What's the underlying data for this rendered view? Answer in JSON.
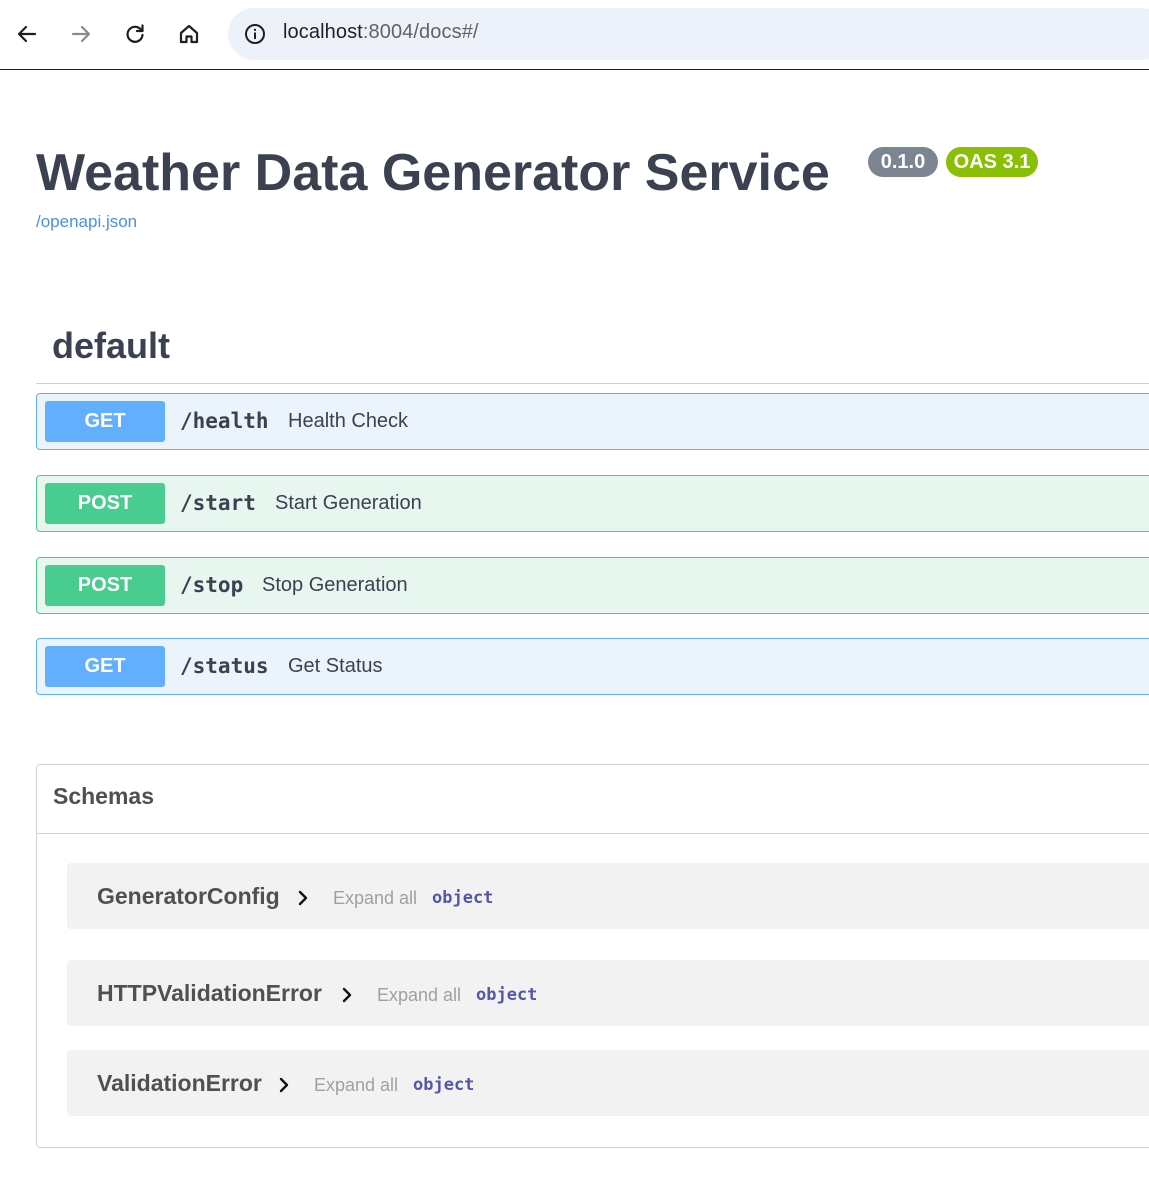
{
  "browser": {
    "url_host": "localhost",
    "url_rest": ":8004/docs#/"
  },
  "header": {
    "title": "Weather Data Generator Service",
    "version_badge": "0.1.0",
    "oas_badge": "OAS 3.1",
    "openapi_link": "/openapi.json"
  },
  "tag": {
    "title": "default"
  },
  "operations": [
    {
      "method": "GET",
      "path": "/health",
      "summary": "Health Check"
    },
    {
      "method": "POST",
      "path": "/start",
      "summary": "Start Generation"
    },
    {
      "method": "POST",
      "path": "/stop",
      "summary": "Stop Generation"
    },
    {
      "method": "GET",
      "path": "/status",
      "summary": "Get Status"
    }
  ],
  "schemas": {
    "title": "Schemas",
    "models": [
      {
        "name": "GeneratorConfig",
        "expand_label": "Expand all",
        "type": "object"
      },
      {
        "name": "HTTPValidationError",
        "expand_label": "Expand all",
        "type": "object"
      },
      {
        "name": "ValidationError",
        "expand_label": "Expand all",
        "type": "object"
      }
    ]
  },
  "colors": {
    "get": "#61affe",
    "post": "#49cc90",
    "version_badge": "#7d8492",
    "oas_badge": "#89bf04",
    "link": "#4990e2"
  }
}
